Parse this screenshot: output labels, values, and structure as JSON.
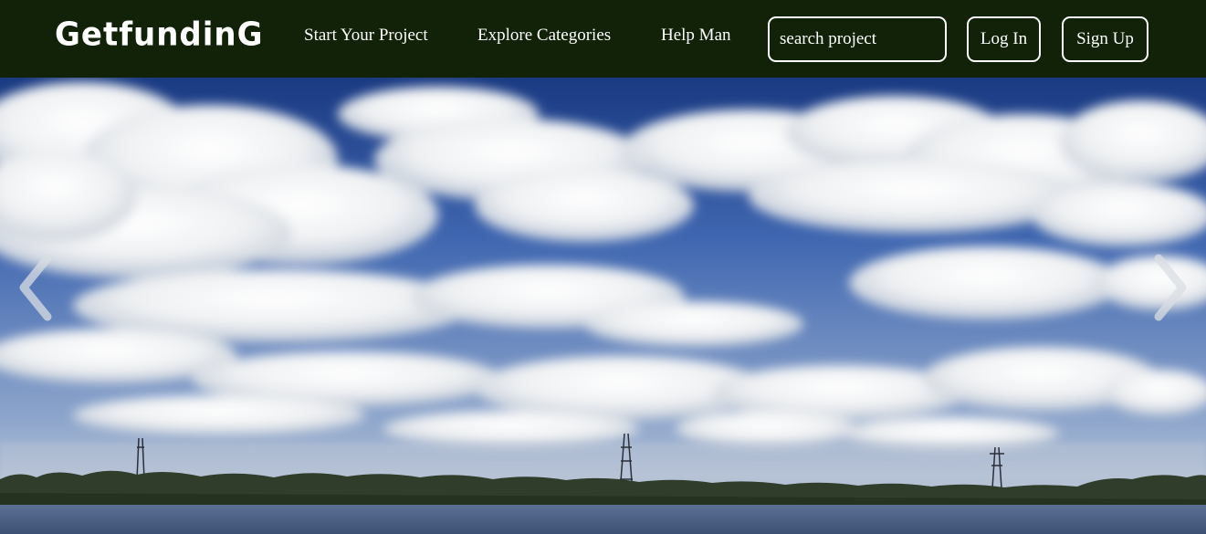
{
  "brand": {
    "logo_text": "GetfundinG"
  },
  "nav": {
    "links": [
      {
        "label": "Start Your Project"
      },
      {
        "label": "Explore Categories"
      },
      {
        "label": "Help Man"
      }
    ]
  },
  "search": {
    "placeholder": "search project",
    "value": ""
  },
  "auth": {
    "login_label": "Log In",
    "signup_label": "Sign Up"
  },
  "carousel": {
    "prev_icon": "chevron-left-icon",
    "next_icon": "chevron-right-icon",
    "slide_image": "sky-with-clouds-over-lake"
  },
  "colors": {
    "navbar_bg": "#112208",
    "nav_text": "#ffffff",
    "sky_top": "#1d3d86",
    "water": "#4a5f82"
  }
}
